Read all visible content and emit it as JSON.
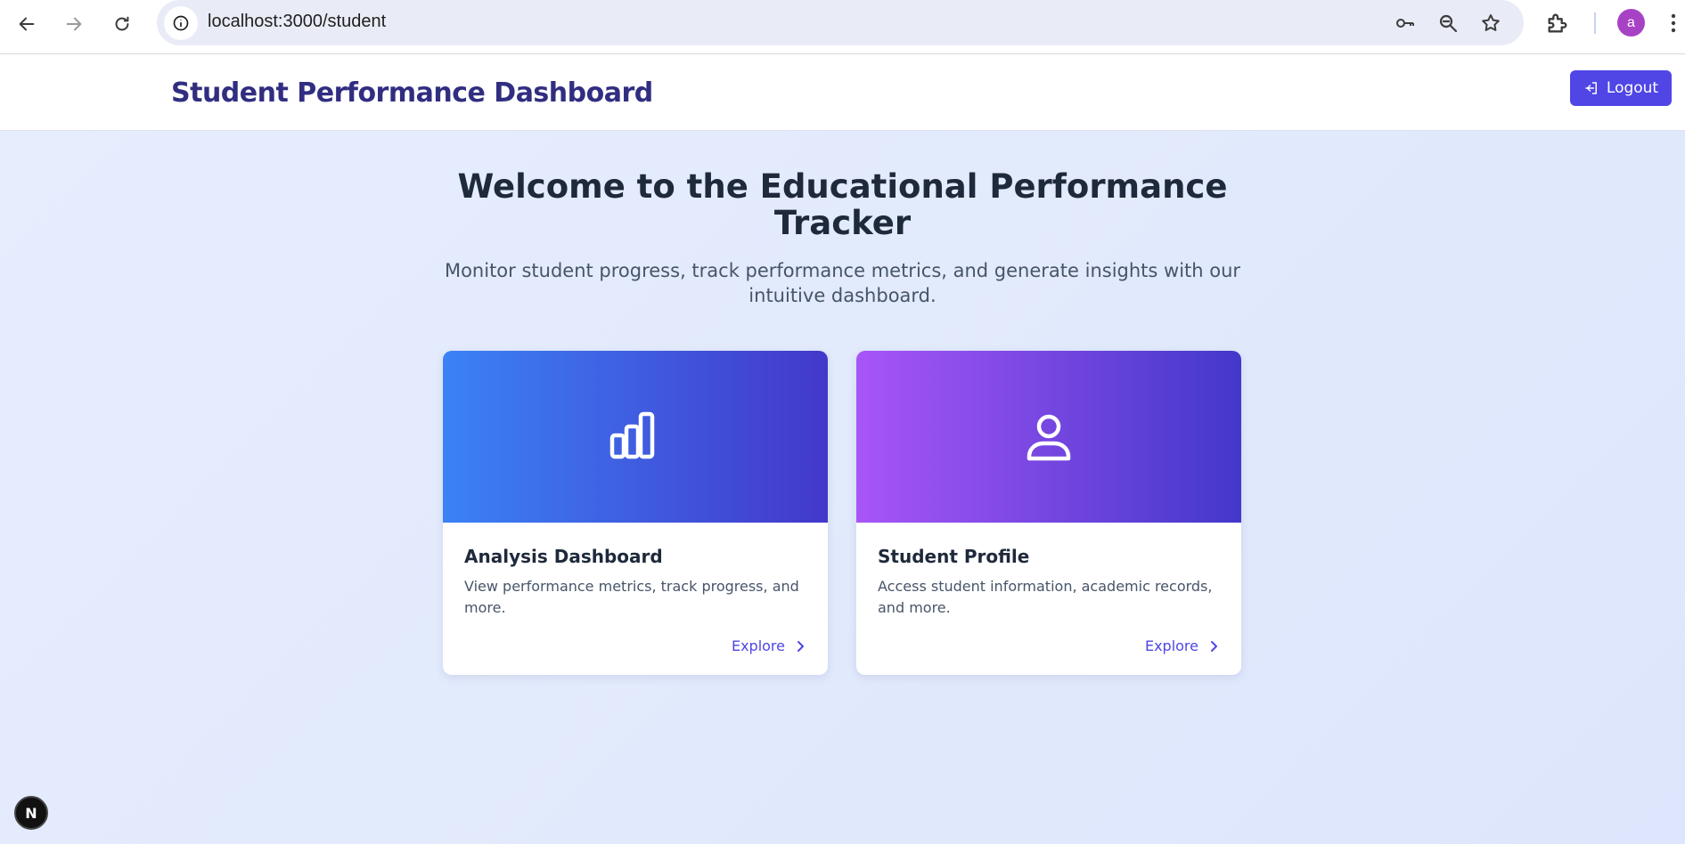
{
  "browser": {
    "url": "localhost:3000/student",
    "profile_initial": "a",
    "icons": [
      "back-arrow-icon",
      "forward-arrow-icon",
      "reload-icon",
      "site-info-icon",
      "key-icon",
      "zoom-icon",
      "star-icon",
      "extensions-icon",
      "menu-dots-icon"
    ]
  },
  "header": {
    "title": "Student Performance Dashboard",
    "logout_label": "Logout"
  },
  "hero": {
    "title_line1": "Welcome to the Educational Performance",
    "title_line2": "Tracker",
    "subtitle_line1": "Monitor student progress, track performance metrics, and generate insights with our",
    "subtitle_line2": "intuitive dashboard."
  },
  "cards": [
    {
      "title": "Analysis Dashboard",
      "description": "View performance metrics, track progress, and more.",
      "link_label": "Explore",
      "icon": "bar-chart-icon"
    },
    {
      "title": "Student Profile",
      "description": "Access student information, academic records, and more.",
      "link_label": "Explore",
      "icon": "user-icon"
    }
  ],
  "dev_badge": "N",
  "colors": {
    "accent": "#4f46e5",
    "title": "#312e81",
    "card1_gradient": [
      "#3b82f6",
      "#4338ca"
    ],
    "card2_gradient": [
      "#a855f7",
      "#4338ca"
    ]
  }
}
